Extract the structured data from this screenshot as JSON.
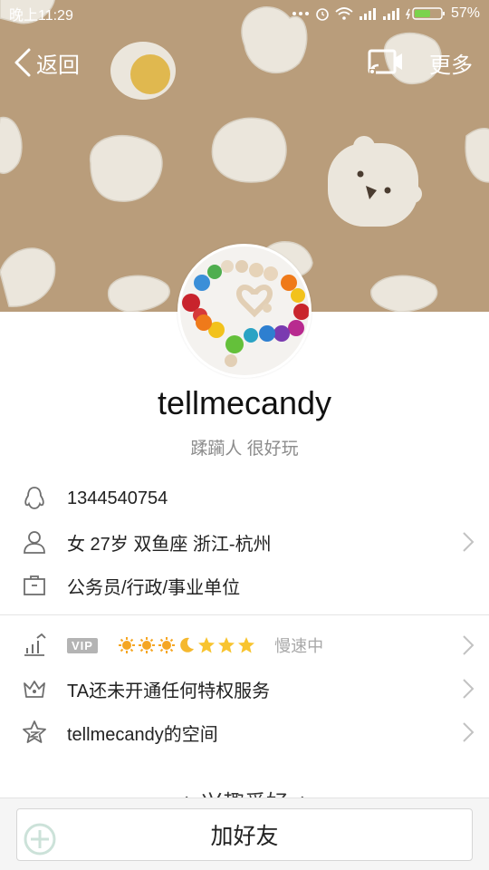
{
  "status_bar": {
    "time": "晚上11:29",
    "battery": "57%"
  },
  "nav": {
    "back_label": "返回",
    "more_label": "更多"
  },
  "profile": {
    "nickname": "tellmecandy",
    "signature": "蹂躏人 很好玩"
  },
  "info": {
    "qq_number": "1344540754",
    "basic": "女  27岁  双鱼座  浙江-杭州",
    "occupation": "公务员/行政/事业单位"
  },
  "level": {
    "badge": "VIP",
    "speed": "慢速中"
  },
  "privilege": "TA还未开通任何特权服务",
  "space": "tellmecandy的空间",
  "section": {
    "title": "兴趣爱好"
  },
  "action": {
    "add_friend": "加好友"
  },
  "colors": {
    "banner": "#b99d7b",
    "bun": "#ebe6dc",
    "text_gray": "#8c8c8c"
  },
  "icons": [
    "chevron-left-icon",
    "screen-cast-icon",
    "penguin-icon",
    "person-icon",
    "briefcase-icon",
    "level-icon",
    "crown-icon",
    "star-icon",
    "chevron-right-icon"
  ]
}
